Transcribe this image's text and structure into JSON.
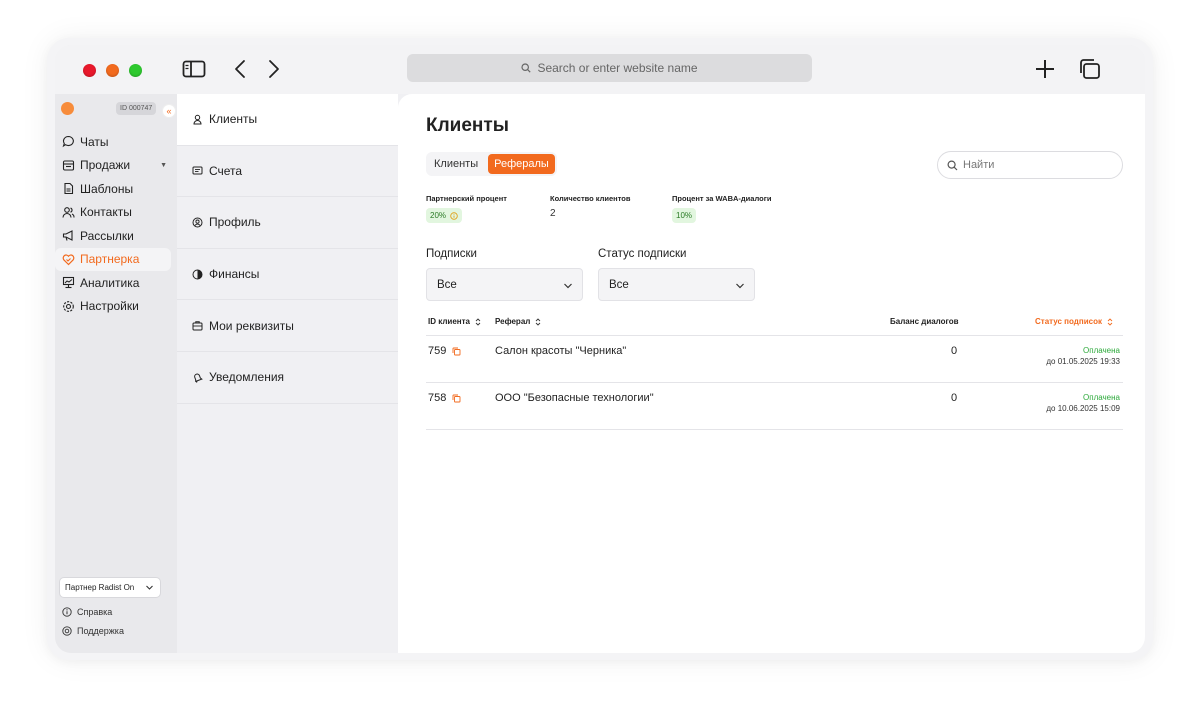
{
  "browser": {
    "url_placeholder": "Search or enter website name"
  },
  "sidebar": {
    "id_badge": "ID 000747",
    "collapse_glyph": "«",
    "items": [
      {
        "label": "Чаты",
        "icon": "chat-icon"
      },
      {
        "label": "Продажи",
        "icon": "sales-icon"
      },
      {
        "label": "Шаблоны",
        "icon": "template-icon"
      },
      {
        "label": "Контакты",
        "icon": "contacts-icon"
      },
      {
        "label": "Рассылки",
        "icon": "megaphone-icon"
      },
      {
        "label": "Партнерка",
        "icon": "partner-icon"
      },
      {
        "label": "Аналитика",
        "icon": "analytics-icon"
      },
      {
        "label": "Настройки",
        "icon": "gear-icon"
      }
    ],
    "partner_select": "Партнер Radist On",
    "help": "Справка",
    "support": "Поддержка"
  },
  "submenu": {
    "items": [
      {
        "label": "Клиенты"
      },
      {
        "label": "Счета"
      },
      {
        "label": "Профиль"
      },
      {
        "label": "Финансы"
      },
      {
        "label": "Мои реквизиты"
      },
      {
        "label": "Уведомления"
      }
    ]
  },
  "main": {
    "title": "Клиенты",
    "tabs": [
      {
        "label": "Клиенты"
      },
      {
        "label": "Рефералы"
      }
    ],
    "search_placeholder": "Найти",
    "stats": {
      "partner_percent_label": "Партнерский процент",
      "partner_percent_value": "20%",
      "clients_count_label": "Количество клиентов",
      "clients_count_value": "2",
      "waba_percent_label": "Процент за WABA-диалоги",
      "waba_percent_value": "10%"
    },
    "filters": {
      "subscriptions_label": "Подписки",
      "subscriptions_value": "Все",
      "status_label": "Статус подписки",
      "status_value": "Все"
    },
    "table": {
      "headers": {
        "id": "ID клиента",
        "referral": "Реферал",
        "balance": "Баланс диалогов",
        "status": "Статус подписок"
      },
      "rows": [
        {
          "id": "759",
          "referral": "Салон красоты \"Черника\"",
          "balance": "0",
          "status": "Оплачена",
          "until": "до 01.05.2025 19:33"
        },
        {
          "id": "758",
          "referral": "ООО \"Безопасные технологии\"",
          "balance": "0",
          "status": "Оплачена",
          "until": "до 10.06.2025 15:09"
        }
      ]
    }
  },
  "colors": {
    "accent": "#f26a1e",
    "paid": "#2eaa3c",
    "pill_bg": "#e2f6df"
  }
}
